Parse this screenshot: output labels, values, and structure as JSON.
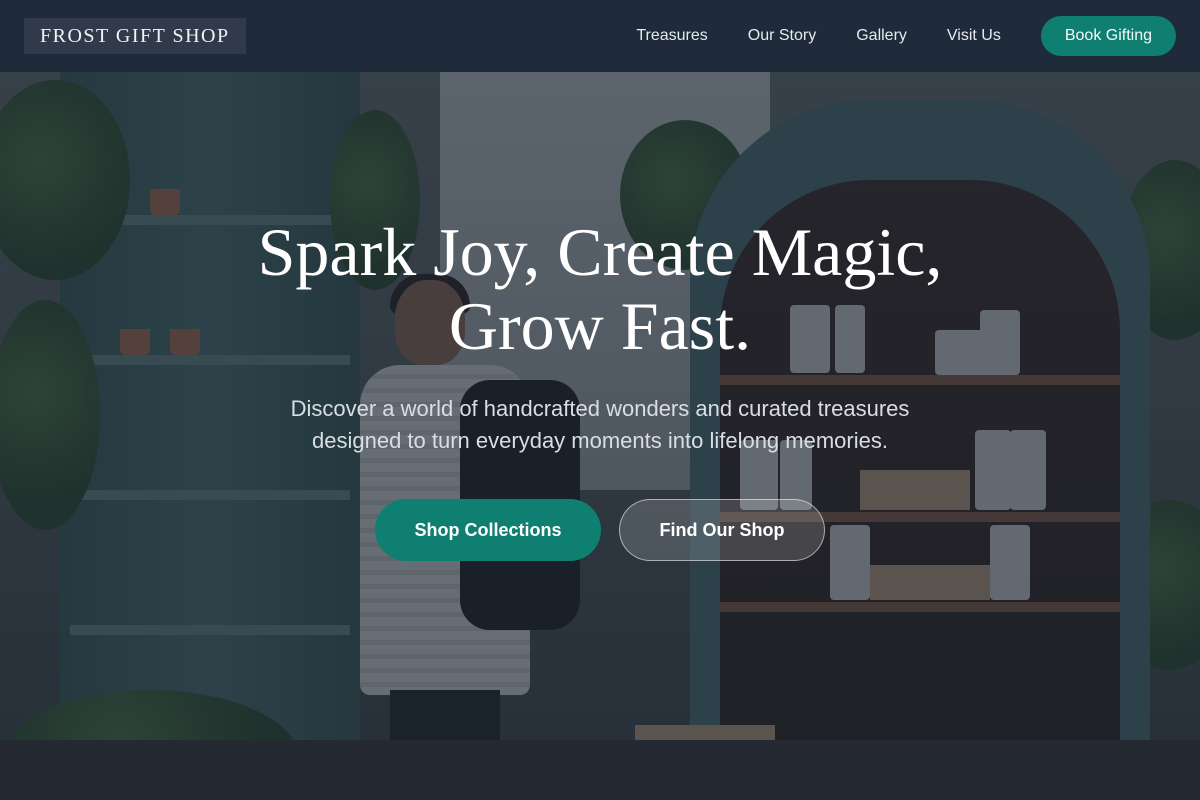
{
  "nav": {
    "brand": "FROST GIFT SHOP",
    "links": [
      "Treasures",
      "Our Story",
      "Gallery",
      "Visit Us"
    ],
    "cta": "Book Gifting"
  },
  "hero": {
    "title_line1": "Spark Joy, Create Magic,",
    "title_line2": "Grow Fast.",
    "subtitle": "Discover a world of handcrafted wonders and curated treasures designed to turn everyday moments into lifelong memories.",
    "primary_button": "Shop Collections",
    "secondary_button": "Find Our Shop",
    "background_photo": "gift-shop-interior-with-shopper"
  },
  "colors": {
    "nav_background": "#1f2a3b",
    "accent": "#0f7f72",
    "hero_overlay": "#182230"
  }
}
